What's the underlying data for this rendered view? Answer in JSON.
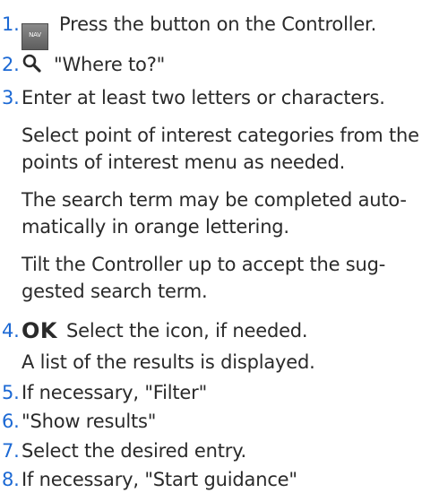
{
  "steps": [
    {
      "num": "1.",
      "icon": "nav-button-icon",
      "icon_label": "NAV",
      "text": "Press the button on the Controller."
    },
    {
      "num": "2.",
      "icon": "search-icon",
      "text": "\"Where to?\""
    },
    {
      "num": "3.",
      "lines": [
        "Enter at least two letters or characters.",
        "Select point of interest categories from the",
        "points of interest menu as needed.",
        "The search term may be completed auto-",
        "matically in orange lettering.",
        "Tilt the Controller up to accept the sug-",
        "gested search term."
      ]
    },
    {
      "num": "4.",
      "icon": "ok-icon",
      "icon_label": "OK",
      "text": "Select the icon, if needed.",
      "sub": "A list of the results is displayed."
    },
    {
      "num": "5.",
      "text": "If necessary, \"Filter\""
    },
    {
      "num": "6.",
      "text": "\"Show results\""
    },
    {
      "num": "7.",
      "text": "Select the desired entry."
    },
    {
      "num": "8.",
      "text": "If necessary, \"Start guidance\""
    }
  ],
  "colors": {
    "step_number": "#1c69d4",
    "text": "#2a2a2a",
    "nav_button": "#6f6f6f"
  }
}
